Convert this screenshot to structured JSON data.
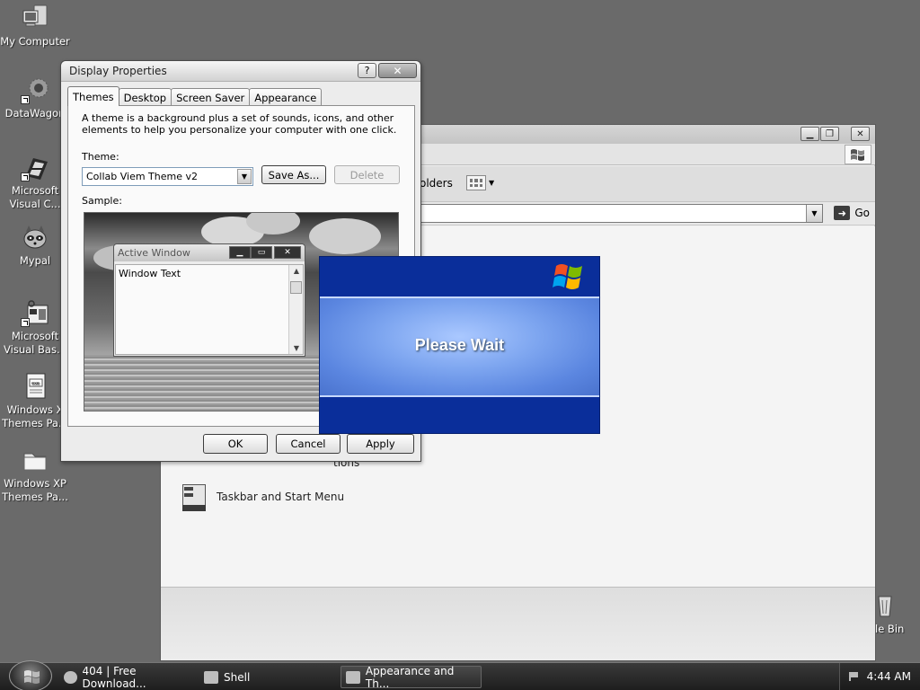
{
  "desktop": {
    "icons": [
      {
        "label": "My Computer"
      },
      {
        "label": "DataWagon"
      },
      {
        "label": "Microsoft Visual C..."
      },
      {
        "label": "Mypal"
      },
      {
        "label": "Microsoft Visual Bas..."
      },
      {
        "label": "Windows X Themes Pa..."
      },
      {
        "label": "Windows XP Themes Pa..."
      },
      {
        "label": "le Bin"
      }
    ]
  },
  "explorer": {
    "toolbar_folders_label": "olders",
    "go_label": "Go",
    "items": [
      {
        "label": "Taskbar and Start Menu"
      },
      {
        "label": "tions"
      }
    ]
  },
  "dialog": {
    "title": "Display Properties",
    "help_label": "?",
    "close_label": "✕",
    "tabs": [
      {
        "label": "Themes"
      },
      {
        "label": "Desktop"
      },
      {
        "label": "Screen Saver"
      },
      {
        "label": "Appearance"
      }
    ],
    "description": "A theme is a background plus a set of sounds, icons, and other elements to help you personalize your computer with one click.",
    "theme_label": "Theme:",
    "theme_value": "Collab Viem Theme v2",
    "save_as_label": "Save As...",
    "delete_label": "Delete",
    "sample_label": "Sample:",
    "preview": {
      "window_title": "Active Window",
      "window_text": "Window Text"
    },
    "ok_label": "OK",
    "cancel_label": "Cancel",
    "apply_label": "Apply"
  },
  "splash": {
    "message": "Please Wait"
  },
  "taskbar": {
    "tasks": [
      {
        "label": "404 | Free Download..."
      },
      {
        "label": "Shell"
      },
      {
        "label": "Appearance and Th..."
      }
    ],
    "clock": "4:44 AM"
  },
  "colors": {
    "splash_blue": "#0a2e9a",
    "splash_band": "#7ea6f0",
    "desktop": "#6a6a6a"
  }
}
